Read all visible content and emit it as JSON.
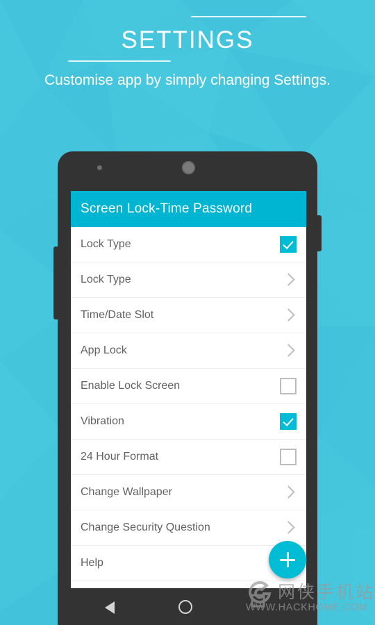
{
  "hero": {
    "title": "SETTINGS",
    "subtitle": "Customise app by simply changing Settings."
  },
  "colors": {
    "background": "#45c6dd",
    "app_bar": "#00b5d1",
    "accent": "#00bcd4",
    "phone_frame": "#333333",
    "row_label": "#616161",
    "chevron": "#bdbdbd"
  },
  "phone": {
    "sensor_icon": "proximity-sensor-dot",
    "camera_icon": "front-camera",
    "volume_button": "volume-rocker",
    "power_button": "power-button"
  },
  "app": {
    "app_bar_title": "Screen Lock-Time Password",
    "rows": [
      {
        "label": "Lock Type",
        "control": "checkbox",
        "checked": true
      },
      {
        "label": "Lock Type",
        "control": "chevron",
        "checked": false
      },
      {
        "label": "Time/Date Slot",
        "control": "chevron",
        "checked": false
      },
      {
        "label": "App Lock",
        "control": "chevron",
        "checked": false
      },
      {
        "label": "Enable Lock Screen",
        "control": "checkbox",
        "checked": false
      },
      {
        "label": "Vibration",
        "control": "checkbox",
        "checked": true
      },
      {
        "label": "24 Hour Format",
        "control": "checkbox",
        "checked": false
      },
      {
        "label": "Change Wallpaper",
        "control": "chevron",
        "checked": false
      },
      {
        "label": "Change Security Question",
        "control": "chevron",
        "checked": false
      },
      {
        "label": "Help",
        "control": "chevron",
        "checked": false
      }
    ],
    "fab": {
      "icon": "plus-icon",
      "label": "+"
    }
  },
  "navbar": {
    "back_icon": "back-triangle-icon",
    "home_icon": "home-circle-icon"
  },
  "watermark": {
    "logo_icon": "hackhome-logo-icon",
    "chinese": "网侠手机站",
    "url": "WWW.HACKHOME.COM"
  }
}
